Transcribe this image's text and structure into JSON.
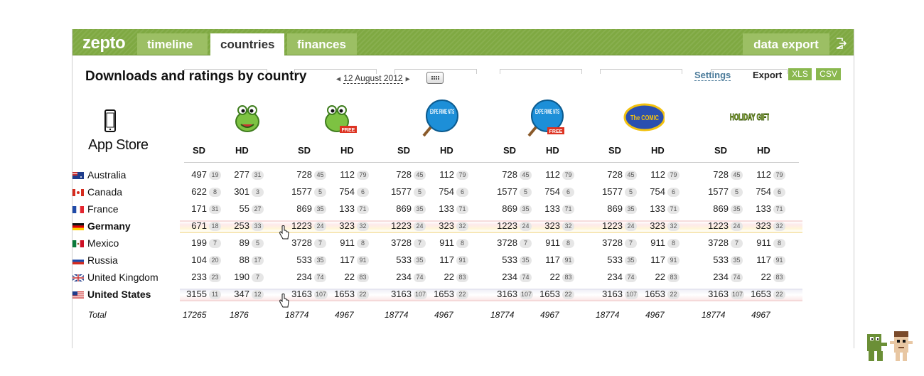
{
  "nav": {
    "logo": "zepto",
    "tabs": [
      "timeline",
      "countries",
      "finances"
    ],
    "active_tab": "countries",
    "data_export": "data export"
  },
  "header": {
    "title": "Downloads and ratings by country",
    "date": "12 August 2012",
    "settings": "Settings",
    "export_label": "Export",
    "xls": "XLS",
    "csv": "CSV"
  },
  "store": {
    "label": "App Store",
    "icon": "smartphone-icon"
  },
  "apps": [
    {
      "icon": "om-nom-icon",
      "badge": ""
    },
    {
      "icon": "om-nom-free-icon",
      "badge": "FREE"
    },
    {
      "icon": "experiments-icon",
      "badge": "",
      "logo_text": "EXPE RIME NTS"
    },
    {
      "icon": "experiments-free-icon",
      "badge": "FREE",
      "logo_text": "EXPE RIME NTS"
    },
    {
      "icon": "the-comic-icon",
      "badge": "",
      "logo_text": "The COMIC"
    },
    {
      "icon": "holiday-gift-icon",
      "badge": "",
      "logo_text": "HOLIDAY GIFT"
    }
  ],
  "column_labels": {
    "sd": "SD",
    "hd": "HD"
  },
  "rows": [
    {
      "country": "Australia",
      "flag": "au-flag",
      "bold": false,
      "cells": [
        [
          "497",
          "19",
          "277",
          "31"
        ],
        [
          "728",
          "45",
          "112",
          "79"
        ],
        [
          "728",
          "45",
          "112",
          "79"
        ],
        [
          "728",
          "45",
          "112",
          "79"
        ],
        [
          "728",
          "45",
          "112",
          "79"
        ],
        [
          "728",
          "45",
          "112",
          "79"
        ]
      ]
    },
    {
      "country": "Canada",
      "flag": "ca-flag",
      "bold": false,
      "cells": [
        [
          "622",
          "8",
          "301",
          "3"
        ],
        [
          "1577",
          "5",
          "754",
          "6"
        ],
        [
          "1577",
          "5",
          "754",
          "6"
        ],
        [
          "1577",
          "5",
          "754",
          "6"
        ],
        [
          "1577",
          "5",
          "754",
          "6"
        ],
        [
          "1577",
          "5",
          "754",
          "6"
        ]
      ]
    },
    {
      "country": "France",
      "flag": "fr-flag",
      "bold": false,
      "cells": [
        [
          "171",
          "31",
          "55",
          "27"
        ],
        [
          "869",
          "35",
          "133",
          "71"
        ],
        [
          "869",
          "35",
          "133",
          "71"
        ],
        [
          "869",
          "35",
          "133",
          "71"
        ],
        [
          "869",
          "35",
          "133",
          "71"
        ],
        [
          "869",
          "35",
          "133",
          "71"
        ]
      ]
    },
    {
      "country": "Germany",
      "flag": "de-flag",
      "bold": true,
      "cells": [
        [
          "671",
          "18",
          "253",
          "33"
        ],
        [
          "1223",
          "24",
          "323",
          "32"
        ],
        [
          "1223",
          "24",
          "323",
          "32"
        ],
        [
          "1223",
          "24",
          "323",
          "32"
        ],
        [
          "1223",
          "24",
          "323",
          "32"
        ],
        [
          "1223",
          "24",
          "323",
          "32"
        ]
      ]
    },
    {
      "country": "Mexico",
      "flag": "mx-flag",
      "bold": false,
      "cells": [
        [
          "199",
          "7",
          "89",
          "5"
        ],
        [
          "3728",
          "7",
          "911",
          "8"
        ],
        [
          "3728",
          "7",
          "911",
          "8"
        ],
        [
          "3728",
          "7",
          "911",
          "8"
        ],
        [
          "3728",
          "7",
          "911",
          "8"
        ],
        [
          "3728",
          "7",
          "911",
          "8"
        ]
      ]
    },
    {
      "country": "Russia",
      "flag": "ru-flag",
      "bold": false,
      "cells": [
        [
          "104",
          "20",
          "88",
          "17"
        ],
        [
          "533",
          "35",
          "117",
          "91"
        ],
        [
          "533",
          "35",
          "117",
          "91"
        ],
        [
          "533",
          "35",
          "117",
          "91"
        ],
        [
          "533",
          "35",
          "117",
          "91"
        ],
        [
          "533",
          "35",
          "117",
          "91"
        ]
      ]
    },
    {
      "country": "United Kingdom",
      "flag": "gb-flag",
      "bold": false,
      "cells": [
        [
          "233",
          "23",
          "190",
          "7"
        ],
        [
          "234",
          "74",
          "22",
          "83"
        ],
        [
          "234",
          "74",
          "22",
          "83"
        ],
        [
          "234",
          "74",
          "22",
          "83"
        ],
        [
          "234",
          "74",
          "22",
          "83"
        ],
        [
          "234",
          "74",
          "22",
          "83"
        ]
      ]
    },
    {
      "country": "United States",
      "flag": "us-flag",
      "bold": true,
      "cells": [
        [
          "3155",
          "11",
          "347",
          "12"
        ],
        [
          "3163",
          "107",
          "1653",
          "22"
        ],
        [
          "3163",
          "107",
          "1653",
          "22"
        ],
        [
          "3163",
          "107",
          "1653",
          "22"
        ],
        [
          "3163",
          "107",
          "1653",
          "22"
        ],
        [
          "3163",
          "107",
          "1653",
          "22"
        ]
      ]
    }
  ],
  "totals": {
    "label": "Total",
    "values": [
      [
        "17265",
        "1876"
      ],
      [
        "18774",
        "4967"
      ],
      [
        "18774",
        "4967"
      ],
      [
        "18774",
        "4967"
      ],
      [
        "18774",
        "4967"
      ],
      [
        "18774",
        "4967"
      ]
    ]
  },
  "colors": {
    "brand_green": "#7fa942",
    "link_blue": "#4a7a99"
  }
}
